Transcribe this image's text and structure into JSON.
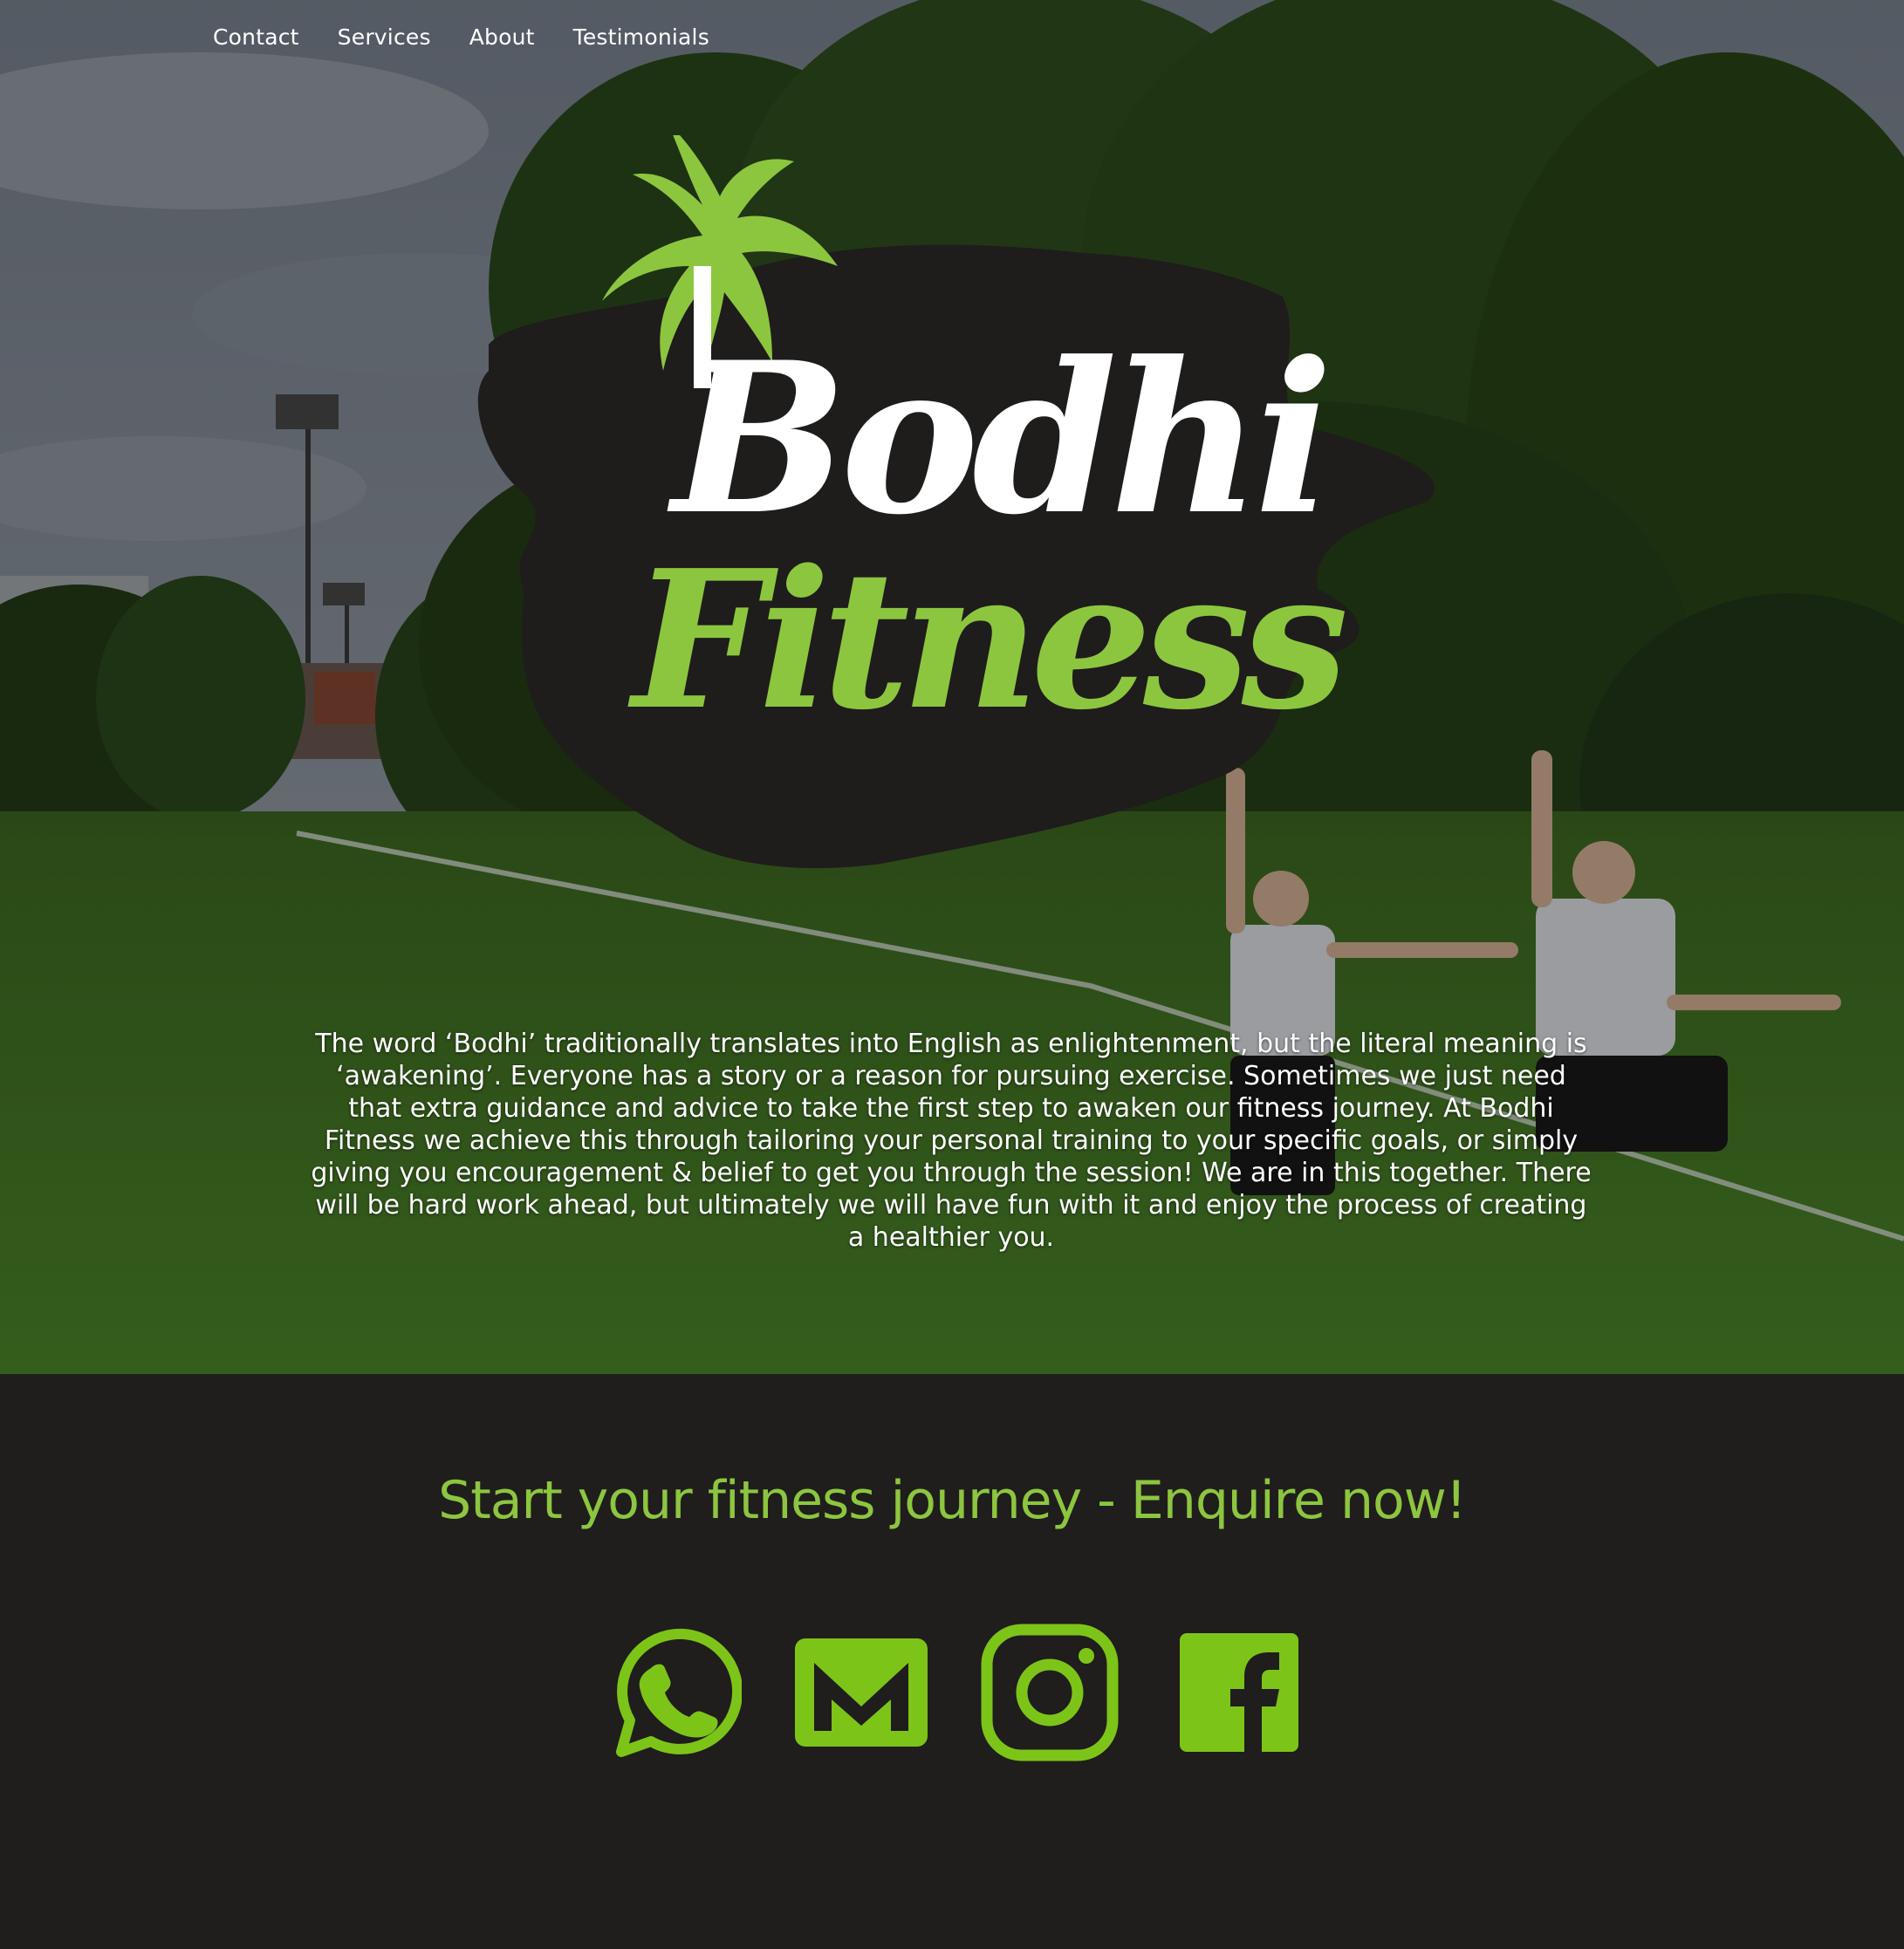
{
  "nav": {
    "items": [
      {
        "label": "Contact"
      },
      {
        "label": "Services"
      },
      {
        "label": "About"
      },
      {
        "label": "Testimonials"
      }
    ]
  },
  "hero": {
    "background_image": "park-field-training-photo",
    "logo": {
      "line1": "Bodhi",
      "line2": "Fitness",
      "icon": "palm-tree-icon"
    },
    "intro_text": "The word ‘Bodhi’ traditionally translates into English as enlightenment, but the literal meaning is ‘awakening’. Everyone has a story or a reason for pursuing exercise. Sometimes we just need that extra guidance and advice to take the first step to awaken our fitness journey. At Bodhi Fitness we achieve this through tailoring your personal training to your specific goals, or simply giving you encouragement & belief to get you through the session! We are in this together. There will be hard work ahead, but ultimately we will have fun with it and enjoy the process of creating a healthier you."
  },
  "cta": {
    "heading": "Start your fitness journey - Enquire now!",
    "socials": [
      {
        "name": "whatsapp",
        "icon": "whatsapp-icon"
      },
      {
        "name": "email",
        "icon": "email-icon"
      },
      {
        "name": "instagram",
        "icon": "instagram-icon"
      },
      {
        "name": "facebook",
        "icon": "facebook-icon"
      }
    ]
  },
  "colors": {
    "accent_green": "#8cc63f",
    "icon_green": "#7dc418",
    "dark_background": "#201d1d",
    "brush_black": "#1f1c1c",
    "text_white": "#ffffff"
  }
}
